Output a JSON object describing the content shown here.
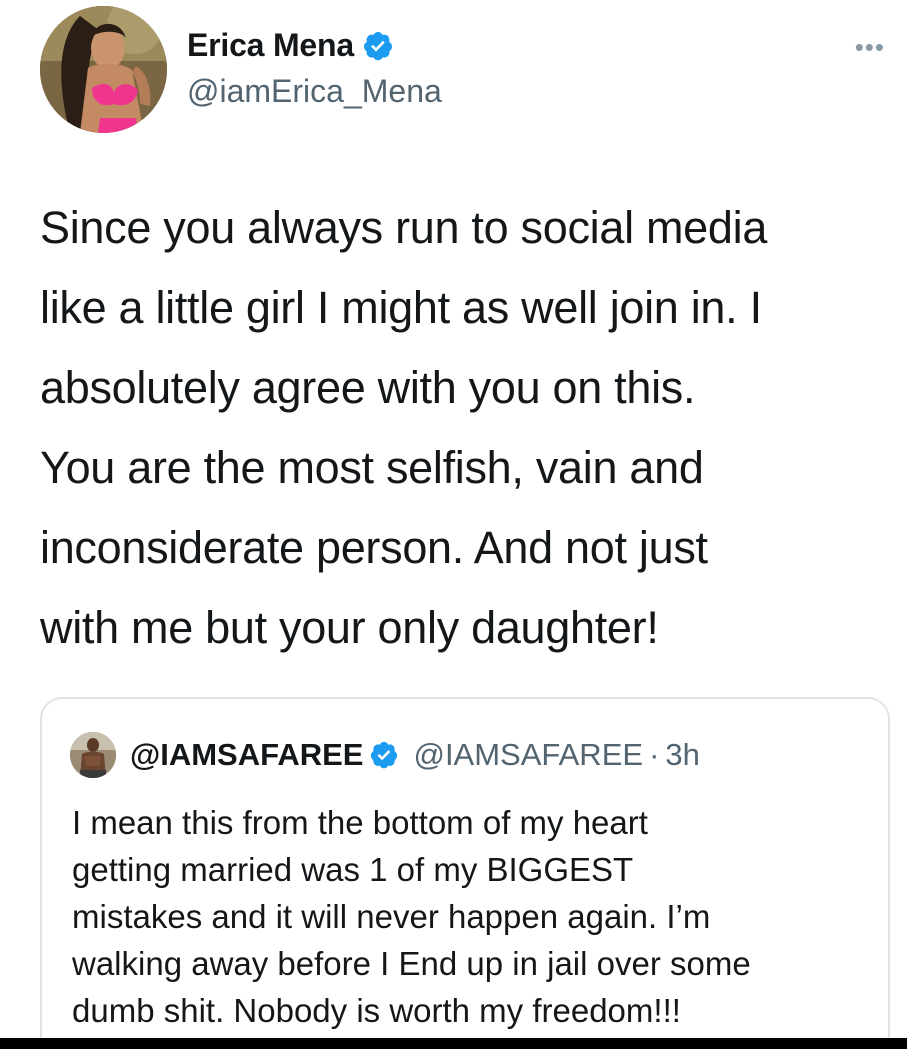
{
  "author": {
    "display_name": "Erica Mena",
    "handle": "@iamErica_Mena",
    "verified": true,
    "avatar_icon": "profile-photo",
    "verified_color": "#1d9bf0"
  },
  "more_menu": {
    "label": "•••",
    "icon": "more-horizontal-icon"
  },
  "tweet": {
    "lines": [
      "Since you always run to social media",
      "like a little girl I might as well join in. I",
      "absolutely agree with you on this.",
      "You are the most selfish, vain and",
      "inconsiderate person. And not just",
      "with me but your only daughter!"
    ]
  },
  "quoted_tweet": {
    "display_name": "@IAMSAFAREE",
    "handle": "@IAMSAFAREE",
    "separator": "·",
    "time": "3h",
    "verified": true,
    "lines": [
      "I mean this from the bottom of my heart",
      "getting married was 1 of my BIGGEST",
      "mistakes and it will never happen again. I’m",
      "walking away before I End up in jail over some",
      "dumb shit. Nobody is worth my freedom!!!"
    ]
  },
  "colors": {
    "text": "#14171a",
    "secondary_text": "#536471",
    "border": "#dfe3e7",
    "accent": "#1d9bf0"
  }
}
